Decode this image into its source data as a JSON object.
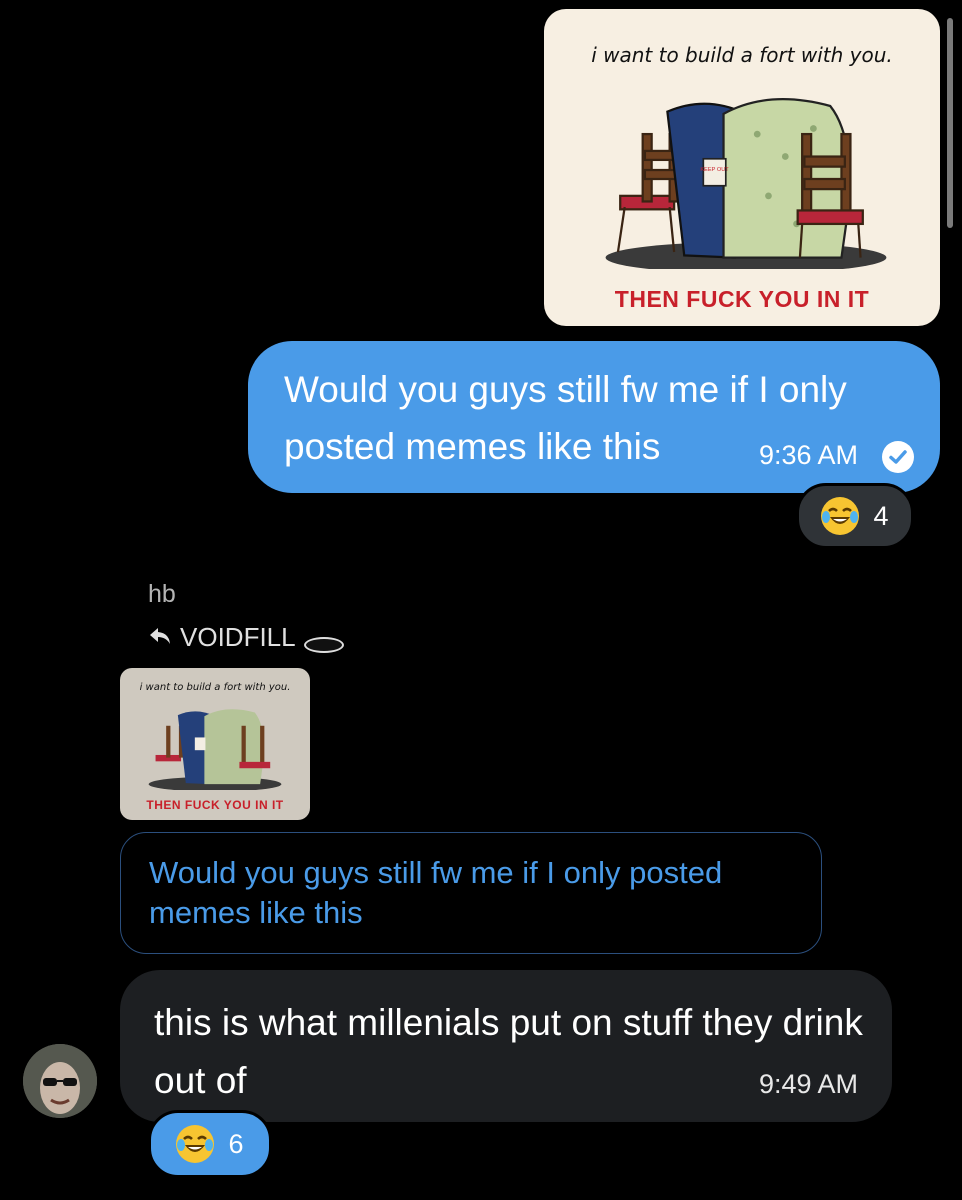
{
  "conversation": {
    "sent_meme": {
      "caption_top": "i want to build a fort with you.",
      "caption_bottom": "THEN FUCK YOU IN IT",
      "sign_text": "KEEP OUT"
    },
    "sent_message": {
      "text": "Would you guys still fw me if I only posted memes like this",
      "time": "9:36 AM",
      "status_icon": "check-circle-icon"
    },
    "sent_reaction": {
      "emoji": "face-with-tears-of-joy",
      "count": "4"
    },
    "reply": {
      "sender": "hb",
      "reply_to_label": "VOIDFILL",
      "quoted_meme": {
        "caption_top": "i want to build a fort with you.",
        "caption_bottom": "THEN FUCK YOU IN IT"
      },
      "quoted_text": "Would you guys still fw me if I only posted memes like this",
      "message": "this is what millenials put on stuff they drink out of",
      "time": "9:49 AM",
      "reaction": {
        "emoji": "face-with-tears-of-joy",
        "count": "6"
      }
    }
  },
  "colors": {
    "background": "#000000",
    "accent_blue": "#4a9be8",
    "incoming_bubble": "#1d1f22",
    "meme_red": "#c8202a"
  }
}
